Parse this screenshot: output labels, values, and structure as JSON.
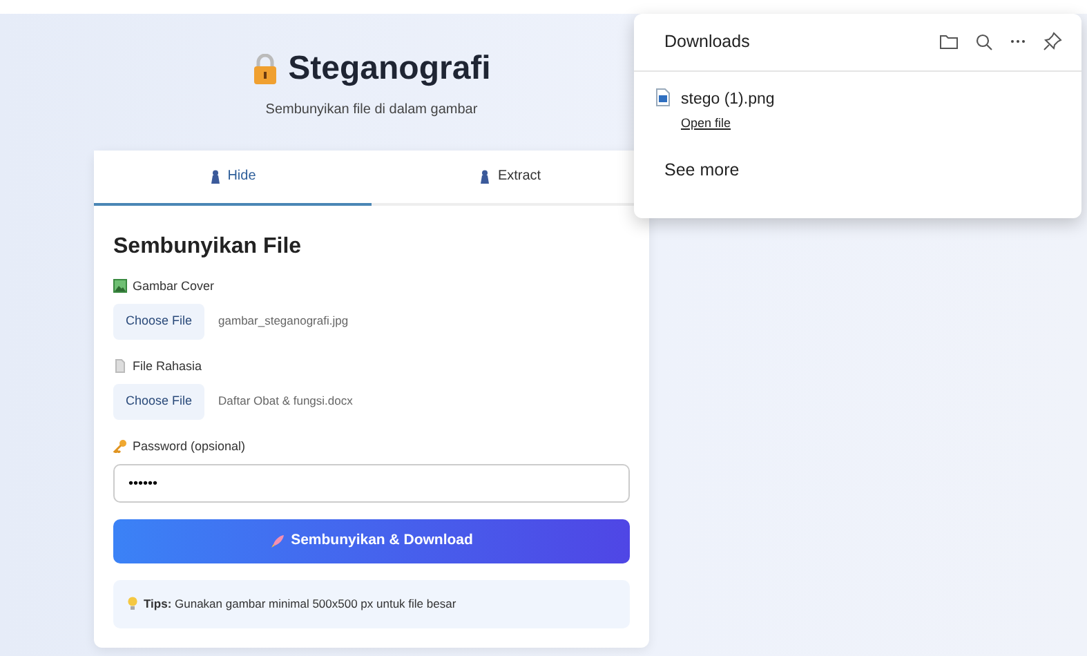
{
  "header": {
    "title": "Steganografi",
    "subtitle": "Sembunyikan file di dalam gambar"
  },
  "tabs": [
    {
      "label": "Hide",
      "selected": true
    },
    {
      "label": "Extract",
      "selected": false
    }
  ],
  "form": {
    "heading": "Sembunyikan File",
    "fields": [
      {
        "kind": "file",
        "label": "Gambar Cover",
        "button": "Choose File",
        "file_name": "gambar_steganografi.jpg"
      },
      {
        "kind": "file",
        "label": "File Rahasia",
        "button": "Choose File",
        "file_name": "Daftar Obat & fungsi.docx"
      },
      {
        "kind": "password",
        "label": "Password (opsional)",
        "value": "••••••"
      }
    ],
    "submit": "Sembunyikan & Download",
    "tip": "**Tips:** Gunakan gambar minimal 500x500 px untuk file besar"
  },
  "downloads": {
    "title": "Downloads",
    "items": [
      {
        "name": "stego (1).png",
        "action": "Open file"
      }
    ],
    "see_more": "See more"
  }
}
